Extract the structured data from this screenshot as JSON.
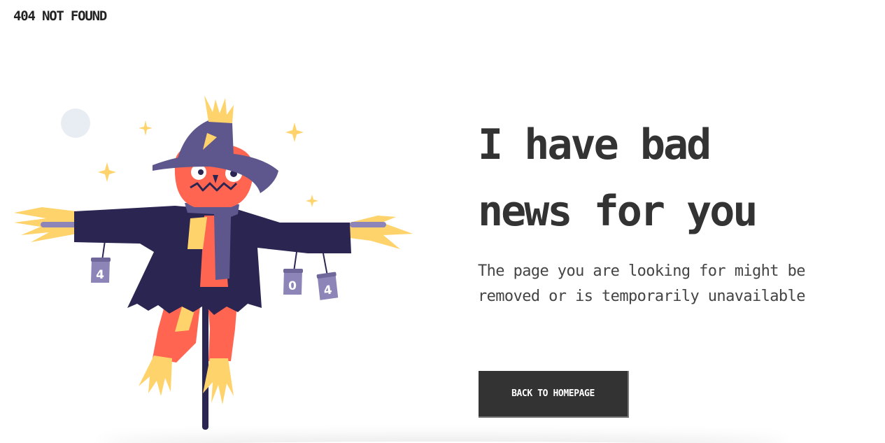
{
  "header": {
    "brand": "404 NOT FOUND"
  },
  "main": {
    "headline": "I have bad news for you",
    "subtext": "The page you are looking for might be removed or is temporarily unavailable",
    "button_label": "BACK TO HOMEPAGE"
  },
  "illustration": {
    "cans": [
      "4",
      "0",
      "4"
    ]
  },
  "colors": {
    "text": "#333333",
    "button_bg": "#333333",
    "coat": "#2B2552",
    "hat": "#5E578D",
    "head": "#FF6550",
    "straw": "#FFD36B",
    "can": "#8D85B8",
    "moon": "#E8ECF3"
  }
}
